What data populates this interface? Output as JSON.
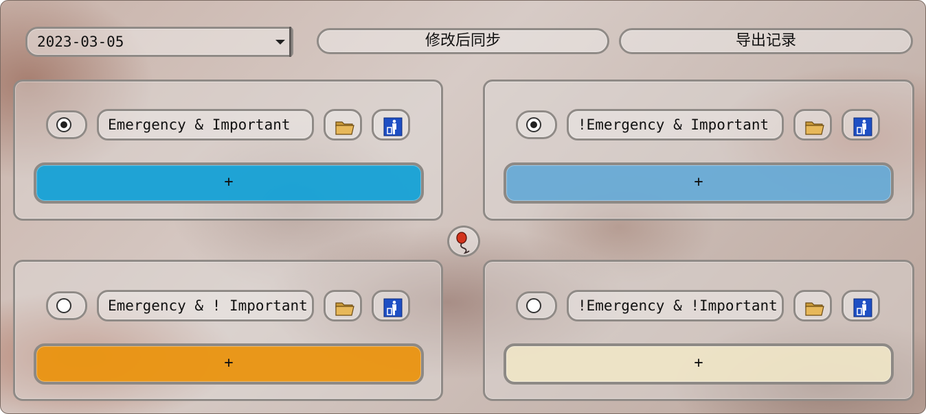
{
  "toolbar": {
    "date_value": "2023-03-05",
    "sync_label": "修改后同步",
    "export_label": "导出记录"
  },
  "quadrants": [
    {
      "title": "Emergency & Important",
      "selected": true,
      "color": "#0fa0d6",
      "add_label": "+"
    },
    {
      "title": "!Emergency & Important",
      "selected": true,
      "color": "#63a9d6",
      "add_label": "+"
    },
    {
      "title": "Emergency & ! Important",
      "selected": false,
      "color": "#ea9410",
      "add_label": "+"
    },
    {
      "title": "!Emergency & !Important",
      "selected": false,
      "color": "#efe6c6",
      "add_label": "+"
    }
  ],
  "icons": {
    "folder": "folder-icon",
    "trash": "trash-icon",
    "center": "balloon-icon"
  }
}
